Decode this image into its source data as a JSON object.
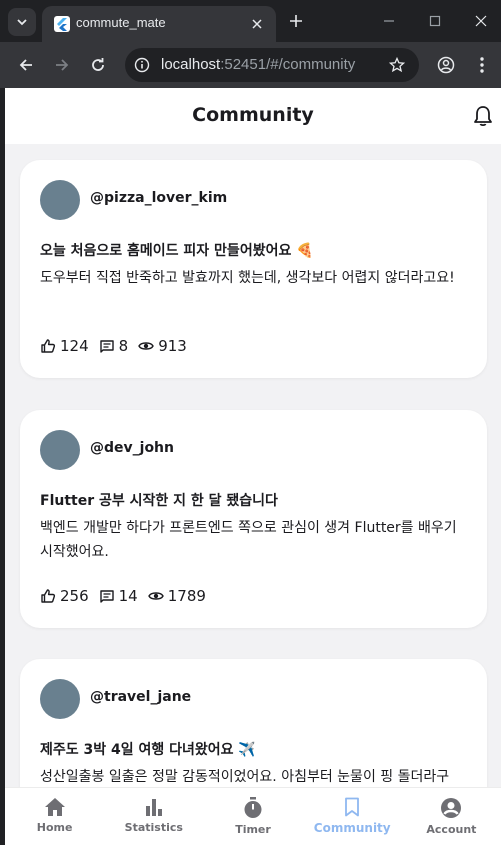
{
  "browser": {
    "tab_title": "commute_mate",
    "url_host": "localhost",
    "url_rest": ":52451/#/community"
  },
  "app": {
    "title": "Community"
  },
  "posts": [
    {
      "username": "@pizza_lover_kim",
      "title": "오늘 처음으로 홈메이드 피자 만들어봤어요 🍕",
      "body": "도우부터 직접 반죽하고 발효까지 했는데, 생각보다 어렵지 않더라고요!",
      "likes": "124",
      "comments": "8",
      "views": "913"
    },
    {
      "username": "@dev_john",
      "title": "Flutter 공부 시작한 지 한 달 됐습니다",
      "body": "백엔드 개발만 하다가 프론트엔드 쪽으로 관심이 생겨 Flutter를 배우기 시작했어요.",
      "likes": "256",
      "comments": "14",
      "views": "1789"
    },
    {
      "username": "@travel_jane",
      "title": "제주도 3박 4일 여행 다녀왔어요 ✈️",
      "body": "성산일출봉 일출은 정말 감동적이었어요. 아침부터 눈물이 핑 돌더라구",
      "likes": "",
      "comments": "",
      "views": ""
    }
  ],
  "bottom_nav": [
    {
      "label": "Home",
      "icon": "home-icon"
    },
    {
      "label": "Statistics",
      "icon": "bar-chart-icon"
    },
    {
      "label": "Timer",
      "icon": "stopwatch-icon"
    },
    {
      "label": "Community",
      "icon": "bookmark-icon",
      "active": true
    },
    {
      "label": "Account",
      "icon": "account-icon"
    }
  ],
  "colors": {
    "accent": "#8fb8f0",
    "avatar": "#69808f",
    "background": "#f2f2f4"
  }
}
